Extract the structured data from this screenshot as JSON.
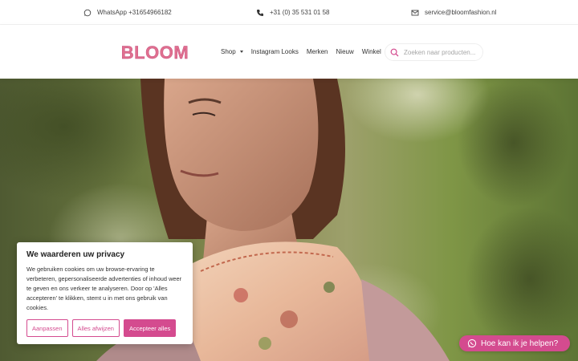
{
  "topbar": {
    "whatsapp": "WhatsApp +31654966182",
    "phone": "+31 (0) 35 531 01 58",
    "email": "service@bloomfashion.nl"
  },
  "header": {
    "logo_text": "BLOOM",
    "nav": [
      {
        "label": "Shop",
        "has_dropdown": true
      },
      {
        "label": "Instagram Looks"
      },
      {
        "label": "Merken"
      },
      {
        "label": "Nieuw"
      },
      {
        "label": "Winkel"
      }
    ],
    "search_placeholder": "Zoeken naar producten..."
  },
  "cookie": {
    "title": "We waarderen uw privacy",
    "text": "We gebruiken cookies om uw browse-ervaring te verbeteren, gepersonaliseerde advertenties of inhoud weer te geven en ons verkeer te analyseren. Door op 'Alles accepteren' te klikken, stemt u in met ons gebruik van cookies.",
    "customize": "Aanpassen",
    "reject": "Alles afwijzen",
    "accept": "Accepteer alles"
  },
  "help": {
    "label": "Hoe kan ik je helpen?"
  },
  "colors": {
    "accent": "#d44b8f",
    "logo": "#e0708f"
  }
}
